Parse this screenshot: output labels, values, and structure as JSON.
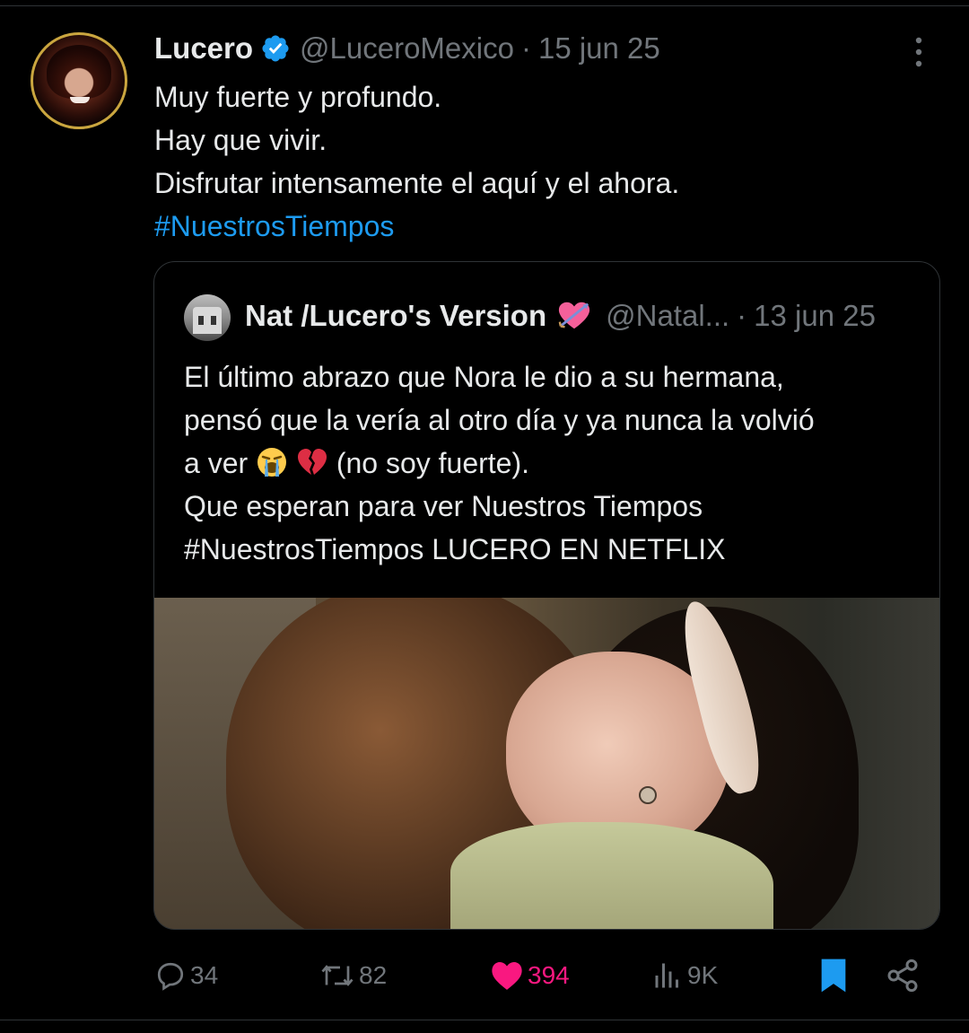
{
  "tweet": {
    "author_name": "Lucero",
    "handle": "@LuceroMexico",
    "separator": "·",
    "date": "15 jun 25",
    "lines": [
      "Muy fuerte y profundo.",
      "Hay que vivir.",
      "Disfrutar intensamente el aquí y el ahora."
    ],
    "hashtag": "#NuestrosTiempos"
  },
  "quote": {
    "author_name": "Nat /Lucero's Version",
    "handle": "@Natal...",
    "date": "13 jun 25",
    "line1": "El último abrazo que Nora le dio a su hermana,",
    "line2": "pensó que la vería al otro día y ya nunca la volvió",
    "line3_start": "a ver",
    "line3_end": "(no soy fuerte).",
    "line4": "Que esperan para ver Nuestros Tiempos",
    "line5": "#NuestrosTiempos LUCERO EN NETFLIX"
  },
  "actions": {
    "replies": "34",
    "reposts": "82",
    "likes": "394",
    "views": "9K"
  },
  "icons": {
    "verified": "verified-badge-icon",
    "more": "more-vertical-icon",
    "heart_arrow": "heart-with-arrow-emoji",
    "crying": "loudly-crying-face-emoji",
    "broken_heart": "broken-heart-emoji",
    "reply": "reply-icon",
    "repost": "repost-icon",
    "like": "heart-icon",
    "views": "views-icon",
    "bookmark": "bookmark-icon",
    "share": "share-icon"
  },
  "colors": {
    "background": "#000000",
    "text": "#e7e9ea",
    "secondary": "#71767b",
    "link": "#1d9bf0",
    "like": "#f91880",
    "bookmark": "#1d9bf0"
  }
}
